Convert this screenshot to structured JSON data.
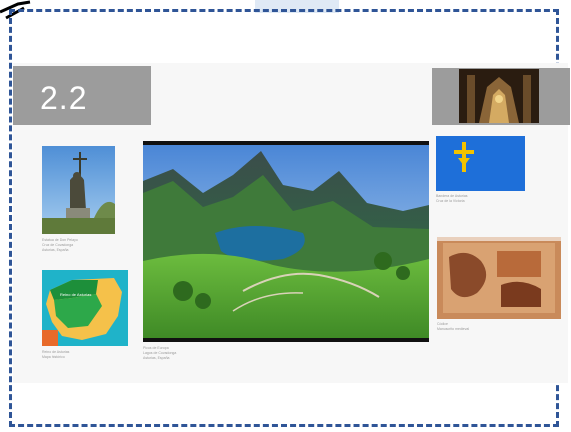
{
  "slide": {
    "title": "2.2"
  },
  "captions": {
    "statue": [
      "Estatua de Don Pelayo",
      "Cruz de Covadonga",
      "Asturias, España",
      ""
    ],
    "map": [
      "Reino de Asturias",
      "Mapa histórico"
    ],
    "main": [
      "Picos de Europa",
      "Lagos de Covadonga",
      "Asturias, España"
    ],
    "flag": [
      "Bandera de Asturias",
      "Cruz de la Victoria"
    ],
    "manuscript": [
      "Códice",
      "Manuscrito medieval"
    ]
  },
  "map_label": "Reino de Asturias",
  "colors": {
    "frame_border": "#2f5597",
    "title_bar": "#9c9c9c",
    "flag_blue": "#1e6fd9",
    "flag_cross": "#f2c200"
  }
}
